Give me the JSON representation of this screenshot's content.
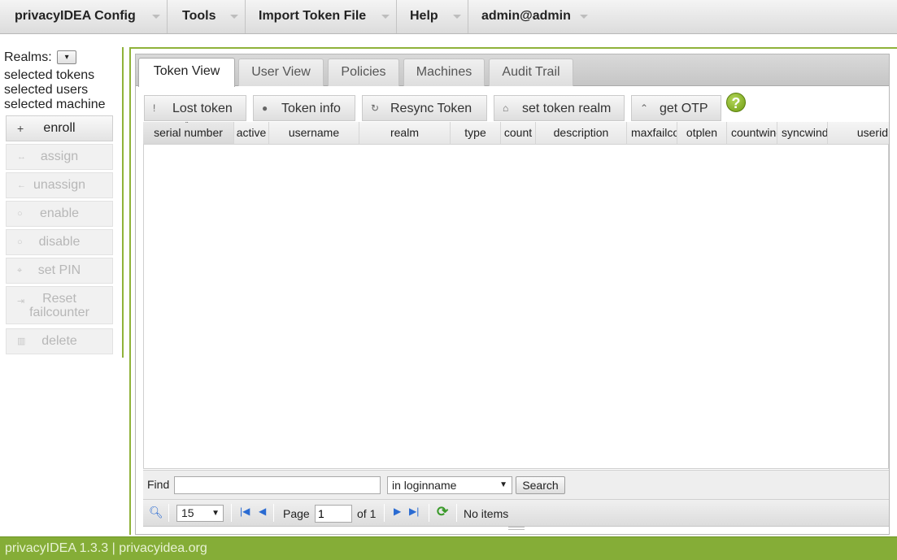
{
  "menu": {
    "items": [
      {
        "label": "privacyIDEA Config"
      },
      {
        "label": "Tools"
      },
      {
        "label": "Import Token File"
      },
      {
        "label": "Help"
      },
      {
        "label": "admin@admin"
      }
    ]
  },
  "left_panel": {
    "realms_label": "Realms:",
    "realm_select_value": "▾",
    "selected_tokens": "selected tokens",
    "selected_users": "selected users",
    "selected_machine": "selected machine",
    "buttons": {
      "enroll": "enroll",
      "assign": "assign",
      "unassign": "unassign",
      "enable": "enable",
      "disable": "disable",
      "set_pin": "set PIN",
      "reset_failcounter_line1": "Reset",
      "reset_failcounter_line2": "failcounter",
      "delete": "delete"
    }
  },
  "tabs": [
    {
      "label": "Token View",
      "selected": true
    },
    {
      "label": "User View"
    },
    {
      "label": "Policies"
    },
    {
      "label": "Machines"
    },
    {
      "label": "Audit Trail"
    }
  ],
  "toolbar": {
    "lost_token": "Lost token",
    "token_info": "Token info",
    "resync_token": "Resync Token",
    "set_token_realm": "set token realm",
    "get_otp": "get OTP",
    "help": "?"
  },
  "grid": {
    "columns": [
      "serial number",
      "active",
      "username",
      "realm",
      "type",
      "count",
      "description",
      "maxfailcount",
      "otplen",
      "countwindow",
      "syncwindow",
      "userid"
    ],
    "sorted_column": "serial number",
    "rows": []
  },
  "search": {
    "find_label": "Find",
    "find_value": "",
    "field_value": "in loginname",
    "search_button": "Search"
  },
  "pager": {
    "rows_per_page": "15",
    "page_label": "Page",
    "page_value": "1",
    "of_label": "of 1",
    "status": "No items"
  },
  "footer": {
    "text": "privacyIDEA 1.3.3 | privacyidea.org"
  },
  "colors": {
    "accent_green": "#8fb23a",
    "footer_green": "#85ad37"
  }
}
